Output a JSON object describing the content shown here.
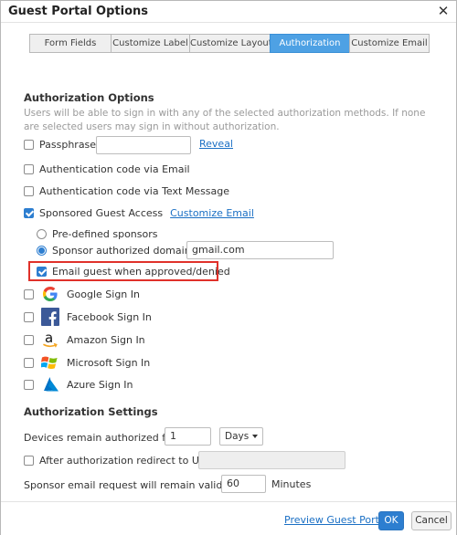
{
  "dialog": {
    "title": "Guest Portal Options",
    "close_glyph": "✕"
  },
  "tabs": [
    {
      "label": "Form Fields",
      "active": false
    },
    {
      "label": "Customize Label",
      "active": false
    },
    {
      "label": "Customize Layout",
      "active": false
    },
    {
      "label": "Authorization",
      "active": true
    },
    {
      "label": "Customize Email",
      "active": false
    }
  ],
  "auth_options": {
    "heading": "Authorization Options",
    "help": "Users will be able to sign in with any of the selected authorization methods. If none are selected users may sign in without authorization.",
    "passphrase": {
      "label": "Passphrase",
      "checked": false,
      "value": "",
      "reveal_label": "Reveal"
    },
    "auth_email": {
      "label": "Authentication code via Email",
      "checked": false
    },
    "auth_sms": {
      "label": "Authentication code via Text Message",
      "checked": false
    },
    "sponsored": {
      "label": "Sponsored Guest Access",
      "checked": true,
      "customize_label": "Customize Email"
    },
    "predefined": {
      "label": "Pre-defined sponsors",
      "selected": false
    },
    "sponsor_domains": {
      "label": "Sponsor authorized domains",
      "selected": true,
      "value": "gmail.com"
    },
    "email_guest": {
      "label": "Email guest when approved/denied",
      "checked": true
    },
    "google": {
      "label": "Google Sign In",
      "checked": false,
      "icon": "google-logo-icon"
    },
    "facebook": {
      "label": "Facebook Sign In",
      "checked": false,
      "icon": "facebook-logo-icon"
    },
    "amazon": {
      "label": "Amazon Sign In",
      "checked": false,
      "icon": "amazon-logo-icon"
    },
    "microsoft": {
      "label": "Microsoft Sign In",
      "checked": false,
      "icon": "microsoft-logo-icon"
    },
    "azure": {
      "label": "Azure Sign In",
      "checked": false,
      "icon": "azure-logo-icon"
    }
  },
  "auth_settings": {
    "heading": "Authorization Settings",
    "devices_label": "Devices remain authorized for",
    "devices_value": "1",
    "devices_unit": "Days",
    "redirect_label": "After authorization redirect to URL",
    "redirect_checked": false,
    "redirect_value": "",
    "sponsor_valid_label": "Sponsor email request will remain valid for",
    "sponsor_valid_value": "60",
    "sponsor_valid_unit": "Minutes"
  },
  "footer": {
    "preview_label": "Preview Guest Portal",
    "ok_label": "OK",
    "cancel_label": "Cancel"
  },
  "colors": {
    "accent": "#2d7ed0",
    "active_tab": "#4ea1e4",
    "highlight_border": "#e0312a",
    "link": "#1a6fc4"
  }
}
